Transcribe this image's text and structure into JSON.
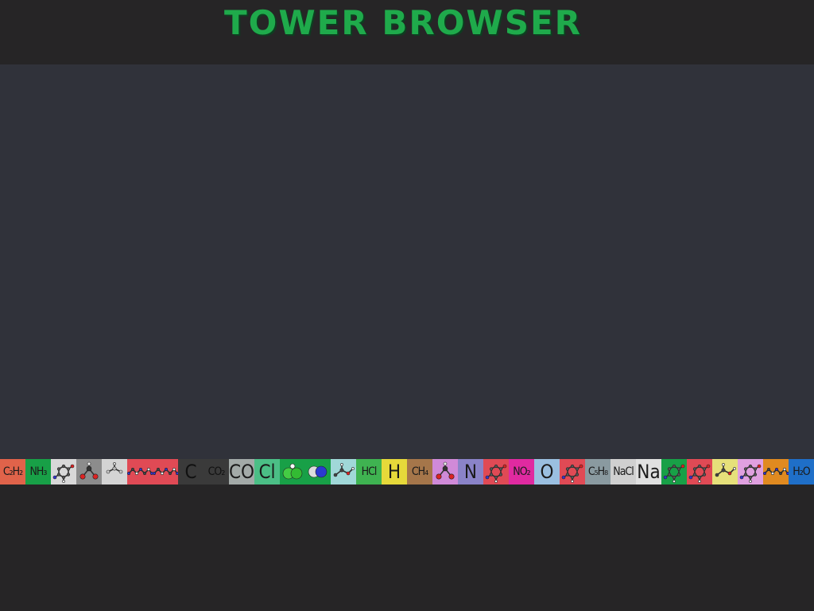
{
  "title": "TOWER BROWSER",
  "colors": {
    "title": "#1faa4b",
    "background": "#262526",
    "panel": "#30323a"
  },
  "tiles": [
    {
      "label": "C₂H₂",
      "bg": "#e0634a",
      "icon": "text"
    },
    {
      "label": "NH₃",
      "bg": "#18a047",
      "icon": "text"
    },
    {
      "label": "",
      "bg": "#d8d8d8",
      "icon": "ring-molecule-icon"
    },
    {
      "label": "",
      "bg": "#8c8c8c",
      "icon": "bent-molecule-icon"
    },
    {
      "label": "",
      "bg": "#d4d4d4",
      "icon": "faint-molecule-icon"
    },
    {
      "label": "",
      "bg": "#e04a55",
      "icon": "chain-molecule-icon"
    },
    {
      "label": "",
      "bg": "#e04a55",
      "icon": "chain-molecule-icon"
    },
    {
      "label": "C",
      "bg": "#3a3a3a",
      "icon": "text-big"
    },
    {
      "label": "CO₂",
      "bg": "#3a3a3a",
      "icon": "text"
    },
    {
      "label": "CO",
      "bg": "#a3aaa8",
      "icon": "text-big"
    },
    {
      "label": "Cl",
      "bg": "#4bbf86",
      "icon": "text-big"
    },
    {
      "label": "",
      "bg": "#18a047",
      "icon": "green-sphere-icon"
    },
    {
      "label": "",
      "bg": "#18a047",
      "icon": "blue-sphere-icon"
    },
    {
      "label": "",
      "bg": "#a0d8d8",
      "icon": "stick-molecule-icon"
    },
    {
      "label": "HCl",
      "bg": "#3fb351",
      "icon": "text"
    },
    {
      "label": "H",
      "bg": "#e6d93a",
      "icon": "text-big"
    },
    {
      "label": "CH₄",
      "bg": "#a5764a",
      "icon": "text"
    },
    {
      "label": "",
      "bg": "#d08ad8",
      "icon": "bent-molecule-icon"
    },
    {
      "label": "N",
      "bg": "#8a83c8",
      "icon": "text-big"
    },
    {
      "label": "",
      "bg": "#e04a55",
      "icon": "ring-molecule-icon"
    },
    {
      "label": "NO₂",
      "bg": "#e02aa0",
      "icon": "text"
    },
    {
      "label": "O",
      "bg": "#9abfe0",
      "icon": "text-big"
    },
    {
      "label": "",
      "bg": "#e04a55",
      "icon": "ring-molecule-icon"
    },
    {
      "label": "C₅H₈",
      "bg": "#8a9aa0",
      "icon": "text"
    },
    {
      "label": "NaCl",
      "bg": "#d0d0d0",
      "icon": "text"
    },
    {
      "label": "Na",
      "bg": "#e0e0e0",
      "icon": "text-big"
    },
    {
      "label": "",
      "bg": "#18a047",
      "icon": "ring-molecule-icon"
    },
    {
      "label": "",
      "bg": "#e04a55",
      "icon": "ring-molecule-icon"
    },
    {
      "label": "",
      "bg": "#e6e07a",
      "icon": "stick-molecule-icon"
    },
    {
      "label": "",
      "bg": "#e0a0e0",
      "icon": "ring-molecule-icon"
    },
    {
      "label": "",
      "bg": "#e08a20",
      "icon": "chain-molecule-icon"
    },
    {
      "label": "H₂O",
      "bg": "#1f6fc8",
      "icon": "text"
    }
  ]
}
